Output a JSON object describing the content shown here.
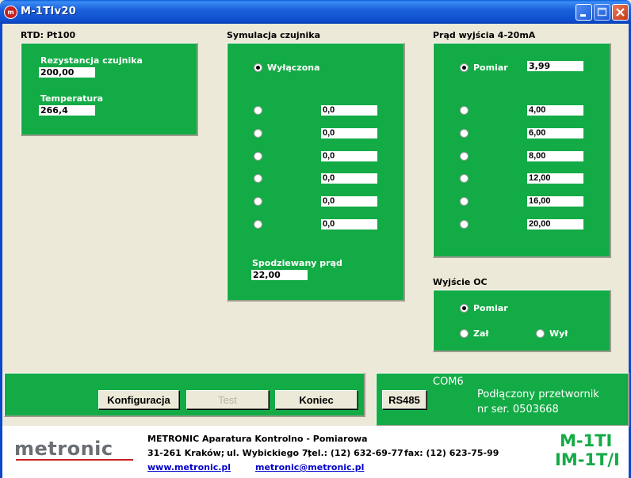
{
  "window": {
    "title": "M-1TIv20",
    "app_icon": "m-logo-icon",
    "icons": [
      "minimize-icon",
      "maximize-icon",
      "close-icon"
    ]
  },
  "rtd": {
    "section_title": "RTD: Pt100",
    "resistance_label": "Rezystancja czujnika",
    "resistance_value": "200,00",
    "temperature_label": "Temperatura",
    "temperature_value": "266,4"
  },
  "simulation": {
    "section_title": "Symulacja czujnika",
    "off_label": "Wyłączona",
    "rows": [
      "0,0",
      "0,0",
      "0,0",
      "0,0",
      "0,0",
      "0,0"
    ],
    "selected": "off",
    "expected_label": "Spodziewany prąd",
    "expected_value": "22,00"
  },
  "output": {
    "section_title": "Prąd wyjścia 4-20mA",
    "measure_label": "Pomiar",
    "measure_value": "3,99",
    "rows": [
      "4,00",
      "6,00",
      "8,00",
      "12,00",
      "16,00",
      "20,00"
    ],
    "selected": "measure"
  },
  "oc": {
    "section_title": "Wyjście OC",
    "measure_label": "Pomiar",
    "on_label": "Zał",
    "off_label": "Wył",
    "selected": "measure"
  },
  "buttons": {
    "config": "Konfiguracja",
    "test": "Test",
    "end": "Koniec",
    "rs485": "RS485"
  },
  "connection": {
    "port": "COM6",
    "status": "Podłączony przetwornik",
    "serial": "nr ser. 0503668"
  },
  "footer": {
    "logo_text": "metronic",
    "company": "METRONIC Aparatura Kontrolno - Pomiarowa",
    "address_city": "31-261 Kraków;",
    "address_street": "ul. Wybickiego 7;",
    "tel": "tel.: (12) 632-69-77",
    "fax": "fax: (12) 623-75-99",
    "website": "www.metronic.pl",
    "email": "metronic@metronic.pl",
    "model_line1": "M-1TI",
    "model_line2": "IM-1T/I"
  },
  "colors": {
    "panel_green": "#13ab45",
    "model_green": "#13ab45",
    "link_blue": "#0000cc",
    "titlebar_blue": "#0a5fd8"
  }
}
